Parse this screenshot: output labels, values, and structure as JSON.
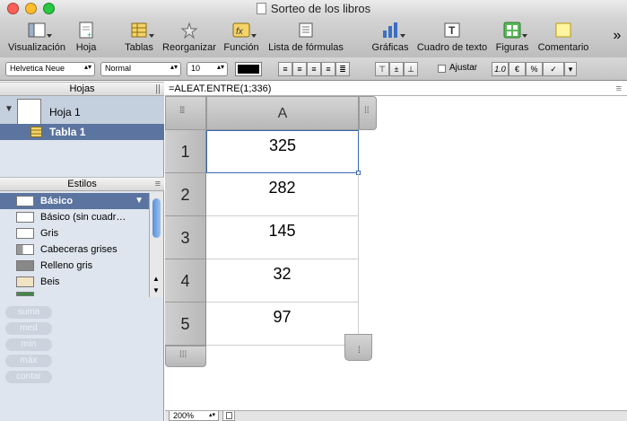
{
  "window": {
    "title": "Sorteo de los libros"
  },
  "toolbar": {
    "items": [
      {
        "label": "Visualización",
        "icon": "view-icon"
      },
      {
        "label": "Hoja",
        "icon": "new-sheet-icon"
      },
      {
        "label": "Tablas",
        "icon": "table-icon"
      },
      {
        "label": "Reorganizar",
        "icon": "reorganize-icon"
      },
      {
        "label": "Función",
        "icon": "function-icon"
      },
      {
        "label": "Lista de fórmulas",
        "icon": "formula-list-icon"
      },
      {
        "label": "Gráficas",
        "icon": "chart-icon"
      },
      {
        "label": "Cuadro de texto",
        "icon": "text-box-icon"
      },
      {
        "label": "Figuras",
        "icon": "shapes-icon"
      },
      {
        "label": "Comentario",
        "icon": "comment-icon"
      }
    ],
    "overflow": "»"
  },
  "format_bar": {
    "font": "Helvetica Neue",
    "style": "Normal",
    "size": "10",
    "wrap_label": "Ajustar",
    "text_color": "#000000",
    "number_buttons": [
      "1.0",
      "€",
      "%",
      "✓"
    ]
  },
  "sidebar": {
    "header": "Hojas",
    "sheets": [
      {
        "name": "Hoja 1",
        "tables": [
          {
            "name": "Tabla 1"
          }
        ]
      }
    ],
    "styles_header": "Estilos",
    "styles": [
      {
        "label": "Básico",
        "selected": true
      },
      {
        "label": "Básico (sin cuadr…"
      },
      {
        "label": "Gris"
      },
      {
        "label": "Cabeceras grises"
      },
      {
        "label": "Relleno gris"
      },
      {
        "label": "Beis"
      }
    ],
    "functions": [
      "suma",
      "med",
      "mín",
      "máx",
      "contar"
    ]
  },
  "formula_bar": {
    "text": "=ALEAT.ENTRE(1;336)"
  },
  "table": {
    "column": "A",
    "rows": [
      {
        "num": "1",
        "value": "325"
      },
      {
        "num": "2",
        "value": "282"
      },
      {
        "num": "3",
        "value": "145"
      },
      {
        "num": "4",
        "value": "32"
      },
      {
        "num": "5",
        "value": "97"
      }
    ]
  },
  "status": {
    "zoom": "200%"
  },
  "colors": {
    "selection": "#3a6ab5",
    "selected_sheet_bg": "#5b74a0",
    "sidebar_bg": "#dfe5ee"
  }
}
